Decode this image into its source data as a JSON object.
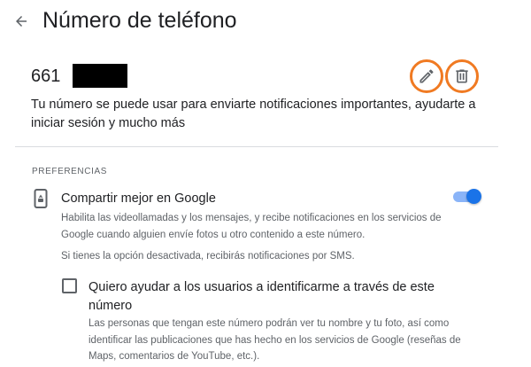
{
  "header": {
    "back_icon": "arrow-back-icon",
    "title": "Número de teléfono"
  },
  "phone": {
    "number_prefix": "661",
    "edit_icon": "pencil-icon",
    "delete_icon": "trash-icon",
    "description": "Tu número se puede usar para enviarte notificaciones importantes, ayudarte a iniciar sesión y mucho más"
  },
  "preferences": {
    "section_label": "PREFERENCIAS",
    "share": {
      "icon": "phone-share-icon",
      "title": "Compartir mejor en Google",
      "toggle_on": true,
      "description": "Habilita las videollamadas y los mensajes, y recibe notificaciones en los servicios de Google cuando alguien envíe fotos u otro contenido a este número.",
      "sms_note": "Si tienes la opción desactivada, recibirás notificaciones por SMS."
    },
    "identify": {
      "checked": false,
      "title": "Quiero ayudar a los usuarios a identificarme a través de este número",
      "description": "Las personas que tengan este número podrán ver tu nombre y tu foto, así como identificar las publicaciones que has hecho en los servicios de Google (reseñas de Maps, comentarios de YouTube, etc.)."
    }
  },
  "colors": {
    "highlight_circle": "#f07a22",
    "toggle_thumb": "#1a73e8",
    "toggle_track": "#8ab4f8",
    "text_primary": "#202124",
    "text_secondary": "#5f6368"
  }
}
